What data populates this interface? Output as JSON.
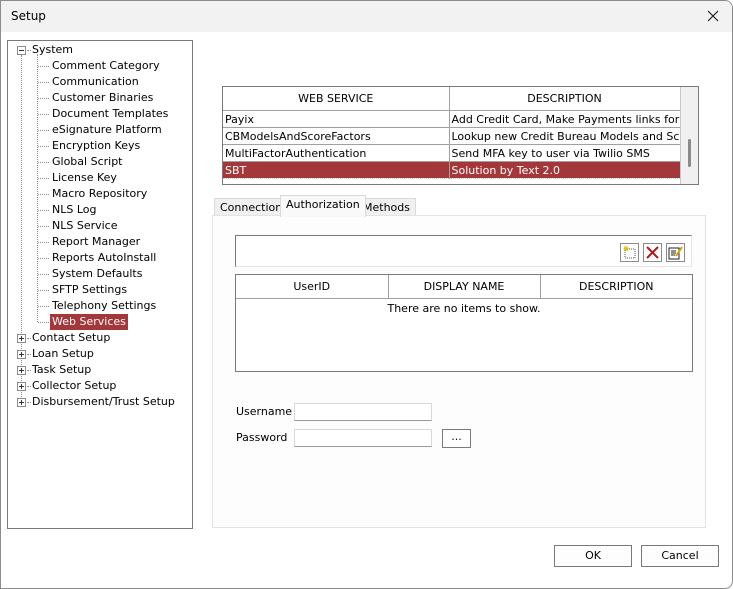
{
  "window": {
    "title": "Setup"
  },
  "tree": {
    "root": {
      "label": "System",
      "expanded": true
    },
    "children": [
      {
        "label": "Comment Category"
      },
      {
        "label": "Communication"
      },
      {
        "label": "Customer Binaries"
      },
      {
        "label": "Document Templates"
      },
      {
        "label": "eSignature Platform"
      },
      {
        "label": "Encryption Keys"
      },
      {
        "label": "Global Script"
      },
      {
        "label": "License Key"
      },
      {
        "label": "Macro Repository"
      },
      {
        "label": "NLS Log"
      },
      {
        "label": "NLS Service"
      },
      {
        "label": "Report Manager"
      },
      {
        "label": "Reports AutoInstall"
      },
      {
        "label": "System Defaults"
      },
      {
        "label": "SFTP Settings"
      },
      {
        "label": "Telephony Settings"
      },
      {
        "label": "Web Services",
        "selected": true
      }
    ],
    "collapsed": [
      {
        "label": "Contact Setup"
      },
      {
        "label": "Loan Setup"
      },
      {
        "label": "Task Setup"
      },
      {
        "label": "Collector Setup"
      },
      {
        "label": "Disbursement/Trust Setup"
      }
    ]
  },
  "services": {
    "columns": [
      "WEB SERVICE",
      "DESCRIPTION"
    ],
    "rows": [
      {
        "name": "Payix",
        "description": "Add Credit Card, Make Payments links for ..."
      },
      {
        "name": "CBModelsAndScoreFactors",
        "description": "Lookup new Credit Bureau Models and Sc..."
      },
      {
        "name": "MultiFactorAuthentication",
        "description": "Send MFA key to user via Twilio SMS"
      },
      {
        "name": "SBT",
        "description": "Solution by Text 2.0",
        "selected": true
      }
    ]
  },
  "tabs": [
    {
      "label": "Connection"
    },
    {
      "label": "Authorization",
      "active": true
    },
    {
      "label": "Methods"
    }
  ],
  "authorization": {
    "toolbar": [
      "new-icon",
      "delete-icon",
      "edit-icon"
    ],
    "users_table": {
      "columns": [
        "UserID",
        "DISPLAY NAME",
        "DESCRIPTION"
      ],
      "empty_text": "There are no items to show."
    },
    "username_label": "Username",
    "username_value": "",
    "password_label": "Password",
    "password_value": "",
    "browse_label": "..."
  },
  "buttons": {
    "ok": "OK",
    "cancel": "Cancel"
  },
  "colors": {
    "selection": "#a4373a"
  }
}
